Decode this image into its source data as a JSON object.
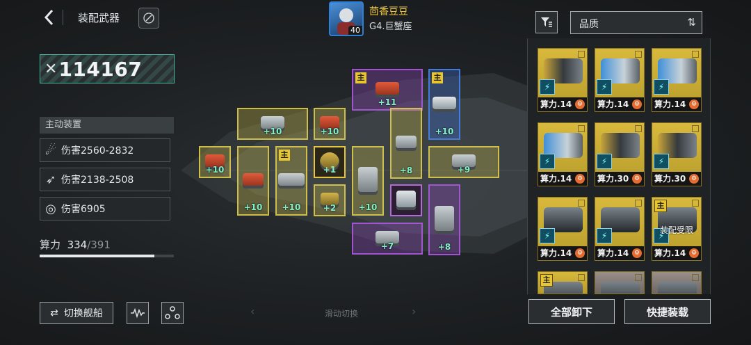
{
  "header": {
    "title": "装配武器"
  },
  "player": {
    "name": "茴香豆豆",
    "level": "40",
    "ship": "G4.巨蟹座"
  },
  "power": {
    "value": "114167"
  },
  "active": {
    "title": "主动装置",
    "skills": [
      {
        "label": "伤害2560-2832",
        "icon": "claw-icon"
      },
      {
        "label": "伤害2138-2508",
        "icon": "missile-icon"
      },
      {
        "label": "伤害6905",
        "icon": "target-icon"
      }
    ]
  },
  "compute": {
    "label": "算力",
    "used": "334",
    "sep": "/",
    "total": "391",
    "fraction": 0.854
  },
  "buttons": {
    "switch_ship": "切换舰船",
    "unequip_all": "全部卸下",
    "quick_equip": "快捷装载"
  },
  "swipe": {
    "label": "滑动切换"
  },
  "sort": {
    "label": "品质"
  },
  "slots": [
    {
      "bonus": "+11",
      "tag": "主"
    },
    {
      "bonus": "+10",
      "tag": "主"
    },
    {
      "bonus": "+10",
      "tag": ""
    },
    {
      "bonus": "+10",
      "tag": ""
    },
    {
      "bonus": "+8",
      "tag": ""
    },
    {
      "bonus": "+10",
      "tag": ""
    },
    {
      "bonus": "+10",
      "tag": ""
    },
    {
      "bonus": "+10",
      "tag": "主"
    },
    {
      "bonus": "+1",
      "tag": ""
    },
    {
      "bonus": "+10",
      "tag": ""
    },
    {
      "bonus": "+9",
      "tag": ""
    },
    {
      "bonus": "+2",
      "tag": ""
    },
    {
      "bonus": "+8",
      "tag": ""
    },
    {
      "bonus": "+7",
      "tag": ""
    }
  ],
  "inventory": [
    {
      "cost": "算力.14",
      "tag": "",
      "limit": ""
    },
    {
      "cost": "算力.14",
      "tag": "",
      "limit": ""
    },
    {
      "cost": "算力.14",
      "tag": "",
      "limit": ""
    },
    {
      "cost": "算力.14",
      "tag": "",
      "limit": ""
    },
    {
      "cost": "算力.30",
      "tag": "",
      "limit": ""
    },
    {
      "cost": "算力.30",
      "tag": "",
      "limit": ""
    },
    {
      "cost": "算力.14",
      "tag": "",
      "limit": ""
    },
    {
      "cost": "算力.14",
      "tag": "",
      "limit": ""
    },
    {
      "cost": "算力.14",
      "tag": "主",
      "limit": "装配受限"
    },
    {
      "cost": "",
      "tag": "主",
      "limit": ""
    },
    {
      "cost": "",
      "tag": "",
      "limit": ""
    },
    {
      "cost": "",
      "tag": "",
      "limit": ""
    }
  ]
}
